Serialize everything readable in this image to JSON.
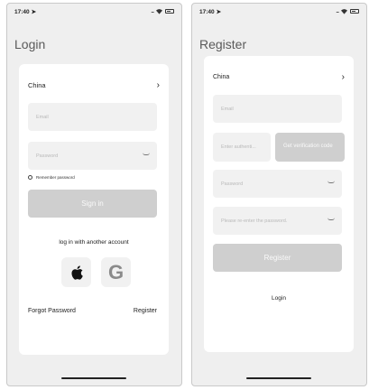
{
  "status_bar": {
    "time": "17:40",
    "location_arrow": "➤",
    "signal": "....",
    "wifi": "wifi-icon",
    "battery": "battery-icon"
  },
  "login": {
    "title": "Login",
    "country": "China",
    "chevron": "›",
    "email_placeholder": "Email",
    "password_placeholder": "Password",
    "remember_label": "Remember password",
    "sign_in_label": "Sign in",
    "alt_login_label": "log in with another account",
    "apple_icon": "apple-icon",
    "google_letter": "G",
    "forgot_label": "Forgot Password",
    "register_link_label": "Register"
  },
  "register": {
    "title": "Register",
    "country": "China",
    "chevron": "›",
    "email_placeholder": "Email",
    "code_placeholder": "Enter authenti...",
    "get_code_label": "Get verification code",
    "password_placeholder": "Password",
    "confirm_placeholder": "Please re-enter the password.",
    "register_button_label": "Register",
    "login_link_label": "Login"
  },
  "colors": {
    "screen_bg": "#efefef",
    "card_bg": "#ffffff",
    "field_bg": "#f1f1f1",
    "button_disabled": "#cfcfcf"
  }
}
